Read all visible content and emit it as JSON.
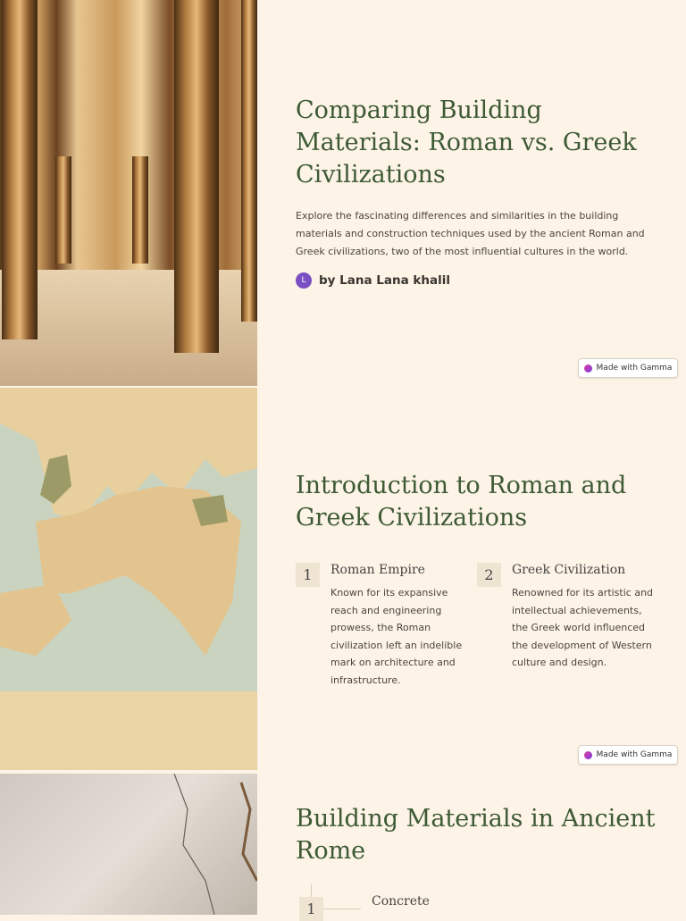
{
  "slide1": {
    "title": "Comparing Building Materials: Roman vs. Greek Civilizations",
    "description": "Explore the fascinating differences and similarities in the building materials and construction techniques used by the ancient Roman and Greek civilizations, two of the most influential cultures in the world.",
    "author_initial": "L",
    "author": "by Lana Lana khalil",
    "badge": "Made with Gamma"
  },
  "slide2": {
    "title": "Introduction to Roman and Greek Civilizations",
    "items": [
      {
        "num": "1",
        "heading": "Roman Empire",
        "body": "Known for its expansive reach and engineering prowess, the Roman civilization left an indelible mark on architecture and infrastructure."
      },
      {
        "num": "2",
        "heading": "Greek Civilization",
        "body": "Renowned for its artistic and intellectual achievements, the Greek world influenced the development of Western culture and design."
      }
    ],
    "badge": "Made with Gamma"
  },
  "slide3": {
    "title": "Building Materials in Ancient Rome",
    "items": [
      {
        "num": "1",
        "heading": "Concrete"
      }
    ]
  }
}
